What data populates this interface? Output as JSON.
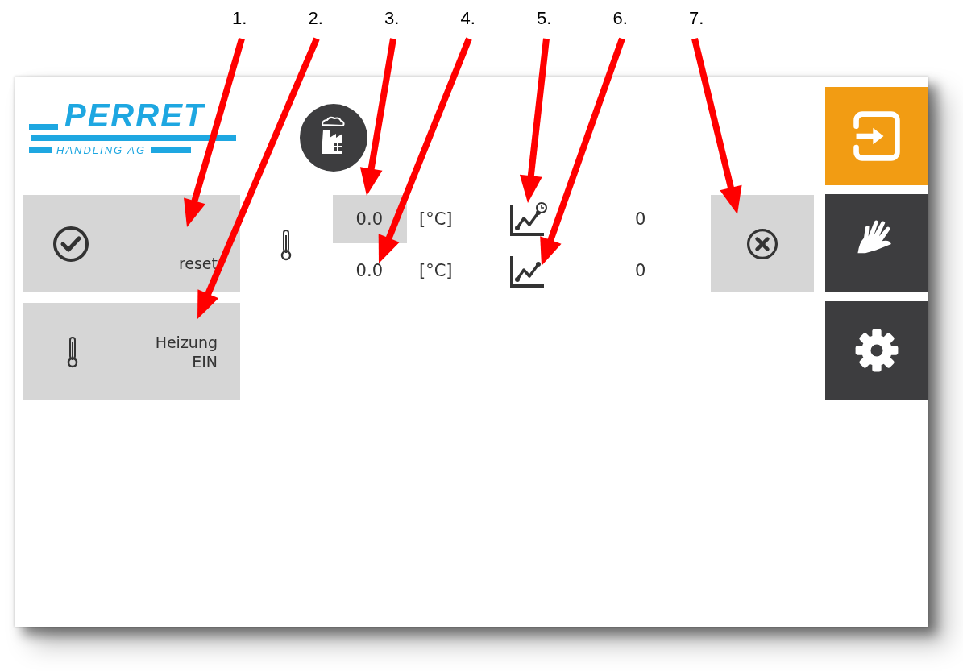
{
  "callouts": [
    {
      "label": "1."
    },
    {
      "label": "2."
    },
    {
      "label": "3."
    },
    {
      "label": "4."
    },
    {
      "label": "5."
    },
    {
      "label": "6."
    },
    {
      "label": "7."
    }
  ],
  "logo": {
    "name": "PERRET",
    "subtitle": "HANDLING AG"
  },
  "left_buttons": [
    {
      "kind": "reset",
      "lines": [
        "reset"
      ]
    },
    {
      "kind": "heating",
      "lines": [
        "Heizung",
        "EIN"
      ]
    }
  ],
  "readings": [
    {
      "value": "0.0",
      "unit": "[°C]",
      "highlighted": true,
      "history": true,
      "count": "0"
    },
    {
      "value": "0.0",
      "unit": "[°C]",
      "highlighted": false,
      "history": false,
      "count": "0"
    }
  ],
  "side_nav": [
    {
      "kind": "login",
      "selected": true
    },
    {
      "kind": "manual",
      "selected": false
    },
    {
      "kind": "settings",
      "selected": false
    }
  ]
}
